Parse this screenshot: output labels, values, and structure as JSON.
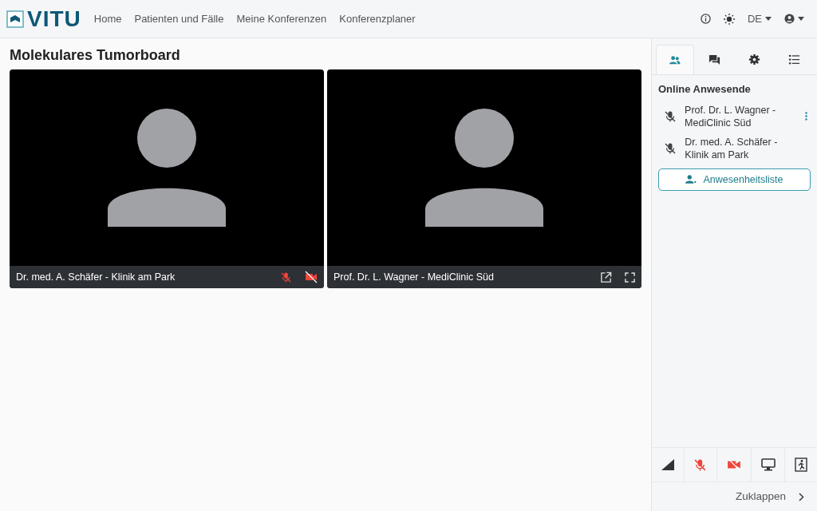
{
  "brand": {
    "name": "VITU"
  },
  "nav": [
    "Home",
    "Patienten und Fälle",
    "Meine Konferenzen",
    "Konferenzplaner"
  ],
  "language": "DE",
  "page_title": "Molekulares Tumorboard",
  "videos": [
    {
      "name": "Dr. med. A. Schäfer - Klinik am Park",
      "kind": "local",
      "mic_muted": true,
      "camera_off": true
    },
    {
      "name": "Prof. Dr. L. Wagner - MediClinic Süd",
      "kind": "remote"
    }
  ],
  "sidebar": {
    "tabs": [
      {
        "kind": "people",
        "selected": true
      },
      {
        "kind": "chat",
        "selected": false
      },
      {
        "kind": "settings",
        "selected": false
      },
      {
        "kind": "list",
        "selected": false
      }
    ],
    "heading": "Online Anwesende",
    "participants": [
      {
        "name": "Prof. Dr. L. Wagner - MediClinic Süd",
        "muted": true,
        "has_menu": true
      },
      {
        "name": "Dr. med. A. Schäfer - Klinik am Park",
        "muted": true,
        "has_menu": false
      }
    ],
    "attendance_button": "Anwesenheitsliste",
    "controls": {
      "mic_muted": true,
      "camera_off": true
    },
    "collapse": "Zuklappen"
  }
}
